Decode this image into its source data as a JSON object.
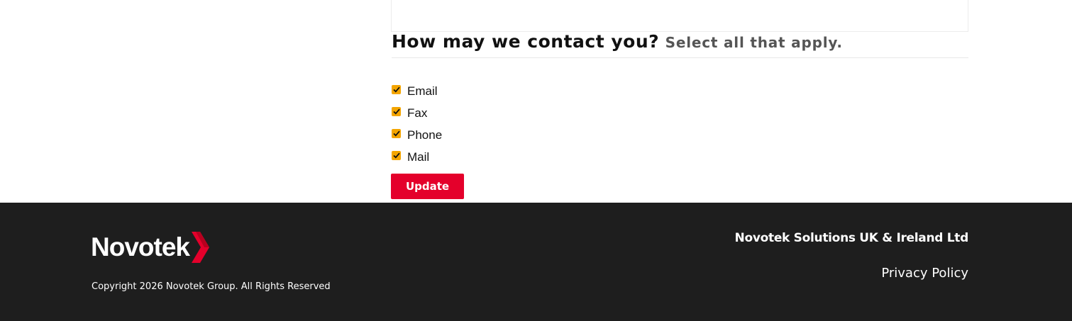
{
  "form": {
    "heading": "How may we contact you?",
    "subheading": "Select all that apply.",
    "options": [
      {
        "label": "Email",
        "checked": true
      },
      {
        "label": "Fax",
        "checked": true
      },
      {
        "label": "Phone",
        "checked": true
      },
      {
        "label": "Mail",
        "checked": true
      }
    ],
    "update_label": "Update"
  },
  "footer": {
    "logo_text": "Novotek",
    "copyright": "Copyright 2026 Novotek Group. All Rights Reserved",
    "company_name": "Novotek Solutions UK & Ireland Ltd",
    "privacy_label": "Privacy Policy"
  },
  "colors": {
    "accent": "#e4002b",
    "checkbox": "#f4a500",
    "footer_bg": "#1e1e1e"
  },
  "icons": {
    "checkbox": "checkmark-icon",
    "logo": "chevron-arrow-icon"
  }
}
